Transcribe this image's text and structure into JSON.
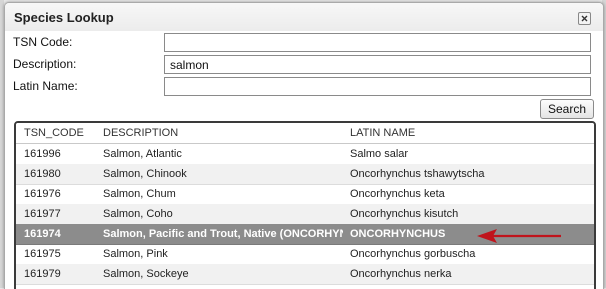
{
  "dialog": {
    "title": "Species Lookup",
    "close_icon": "close-icon"
  },
  "form": {
    "tsn_label": "TSN Code:",
    "tsn_value": "",
    "description_label": "Description:",
    "description_value": "salmon",
    "latin_label": "Latin Name:",
    "latin_value": ""
  },
  "search_button": "Search",
  "results": {
    "columns": [
      "TSN_CODE",
      "DESCRIPTION",
      "LATIN NAME"
    ],
    "rows": [
      {
        "tsn": "161996",
        "description": "Salmon, Atlantic",
        "latin": "Salmo salar"
      },
      {
        "tsn": "161980",
        "description": "Salmon, Chinook",
        "latin": "Oncorhynchus tshawytscha"
      },
      {
        "tsn": "161976",
        "description": "Salmon, Chum",
        "latin": "Oncorhynchus keta"
      },
      {
        "tsn": "161977",
        "description": "Salmon, Coho",
        "latin": "Oncorhynchus kisutch"
      },
      {
        "tsn": "161974",
        "description": "Salmon, Pacific and Trout, Native (ONCORHYNCHUS",
        "latin": "ONCORHYNCHUS"
      },
      {
        "tsn": "161975",
        "description": "Salmon, Pink",
        "latin": "Oncorhynchus gorbuscha"
      },
      {
        "tsn": "161979",
        "description": "Salmon, Sockeye",
        "latin": "Oncorhynchus nerka"
      }
    ],
    "selected_row": 4
  },
  "annotation": {
    "arrow_icon": "red-arrow-icon",
    "color": "#c0141c"
  }
}
